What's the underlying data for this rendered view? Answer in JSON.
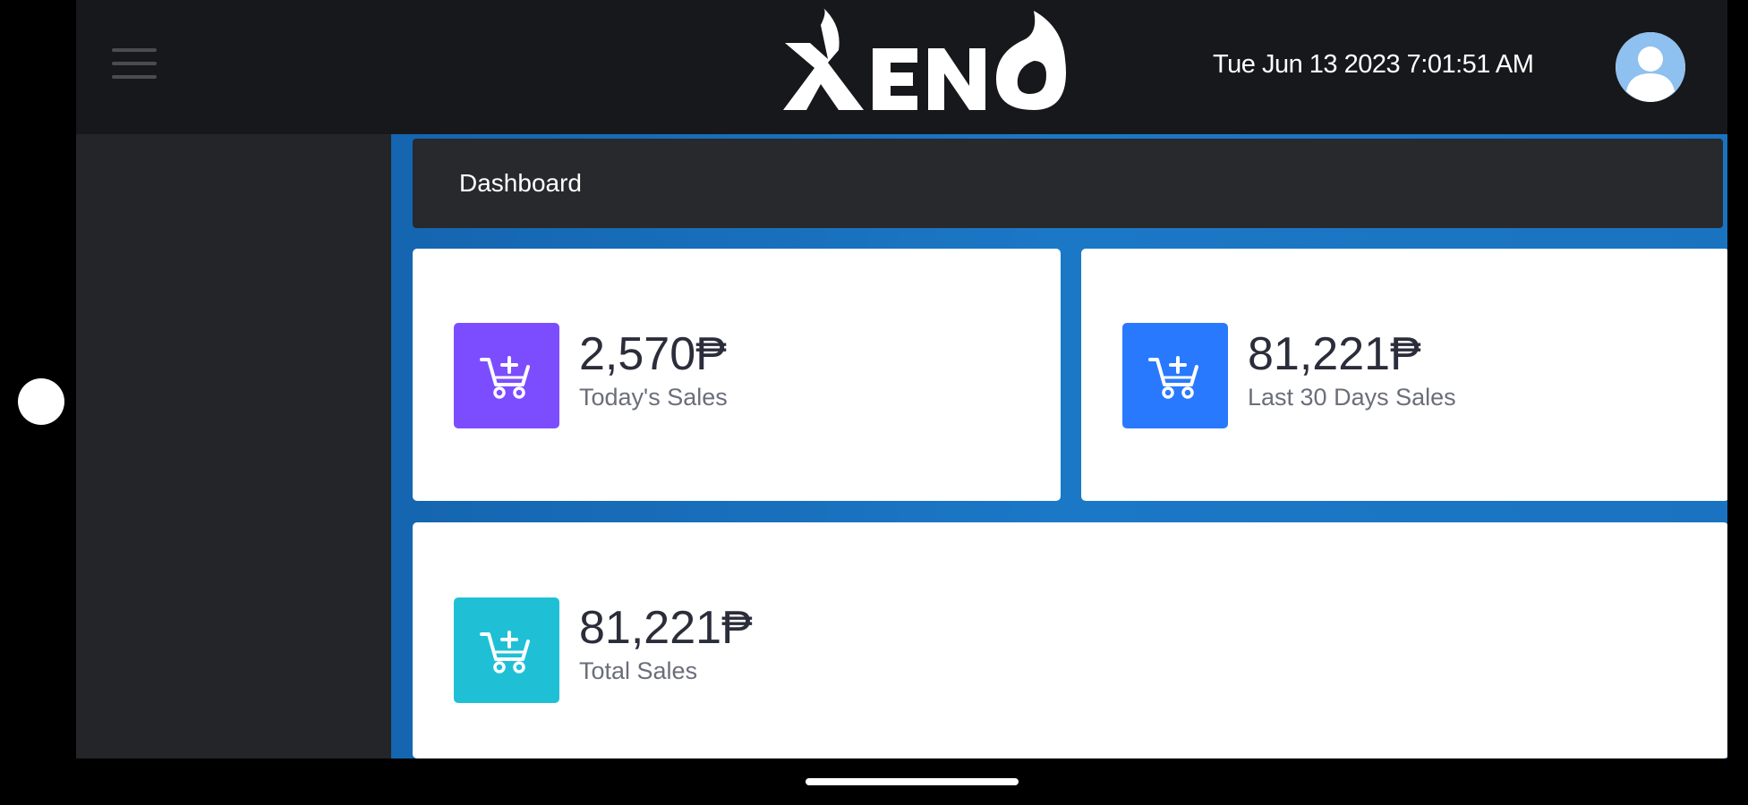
{
  "header": {
    "datetime": "Tue Jun 13 2023 7:01:51 AM",
    "logo_text": "XENO"
  },
  "page": {
    "title": "Dashboard"
  },
  "cards": [
    {
      "value": "2,570₱",
      "label": "Today's Sales",
      "color": "#7c4dff",
      "icon": "cart-plus-icon"
    },
    {
      "value": "81,221₱",
      "label": "Last 30 Days Sales",
      "color": "#2979ff",
      "icon": "cart-plus-icon"
    },
    {
      "value": "81,221₱",
      "label": "Total Sales",
      "color": "#1fc0d6",
      "icon": "cart-plus-icon"
    }
  ],
  "colors": {
    "topbar": "#17181b",
    "sidebar": "#242528",
    "main": "#1a73c0"
  }
}
